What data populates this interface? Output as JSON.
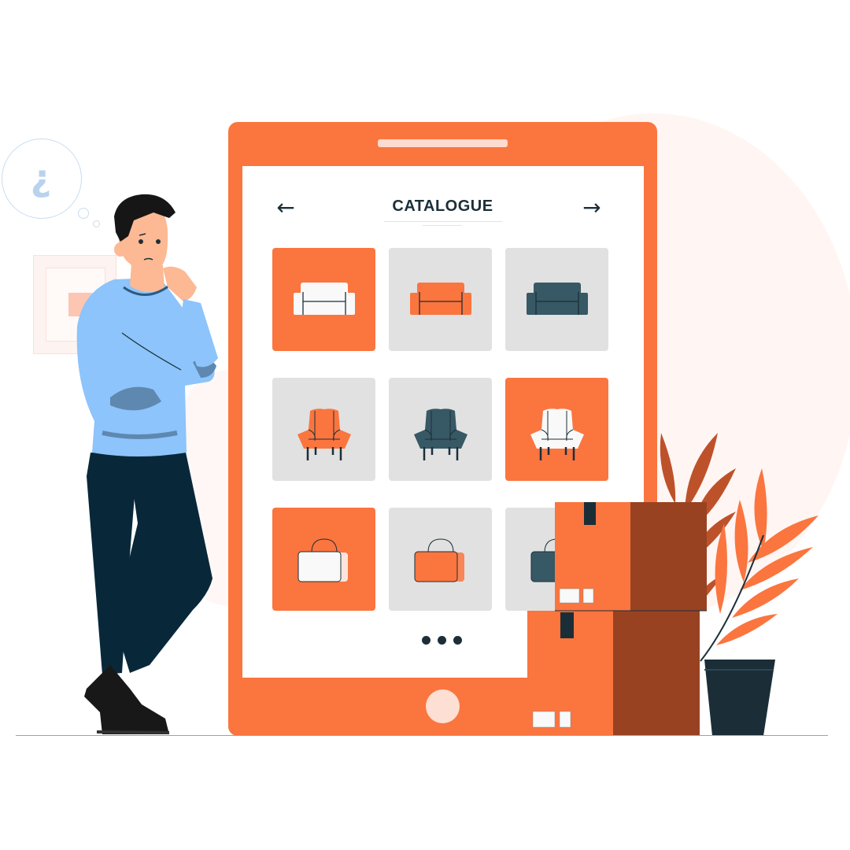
{
  "catalogue": {
    "title": "CATALOGUE",
    "prev_label": "←",
    "next_label": "→",
    "colors": {
      "accent": "#fb753f",
      "tile_inactive": "#e1e1e1",
      "dark": "#1c2f38",
      "teal": "#375865",
      "white_item": "#f9f9f9",
      "box_side": "#984222"
    },
    "rows": [
      {
        "category": "sofa",
        "items": [
          {
            "name": "white-sofa",
            "selected": true,
            "item_color": "#f9f9f9"
          },
          {
            "name": "orange-sofa",
            "selected": false,
            "item_color": "#fb753f"
          },
          {
            "name": "teal-sofa",
            "selected": false,
            "item_color": "#375865"
          }
        ]
      },
      {
        "category": "armchair",
        "items": [
          {
            "name": "orange-armchair",
            "selected": false,
            "item_color": "#fb753f"
          },
          {
            "name": "teal-armchair",
            "selected": false,
            "item_color": "#375865"
          },
          {
            "name": "white-armchair",
            "selected": true,
            "item_color": "#f9f9f9"
          }
        ]
      },
      {
        "category": "bag",
        "items": [
          {
            "name": "white-bag",
            "selected": true,
            "item_color": "#f9f9f9"
          },
          {
            "name": "orange-bag",
            "selected": false,
            "item_color": "#fb753f"
          },
          {
            "name": "teal-bag",
            "selected": false,
            "item_color": "#375865"
          }
        ]
      }
    ],
    "pagination": "more-dots"
  },
  "thought_bubble": {
    "glyph": "¿"
  }
}
